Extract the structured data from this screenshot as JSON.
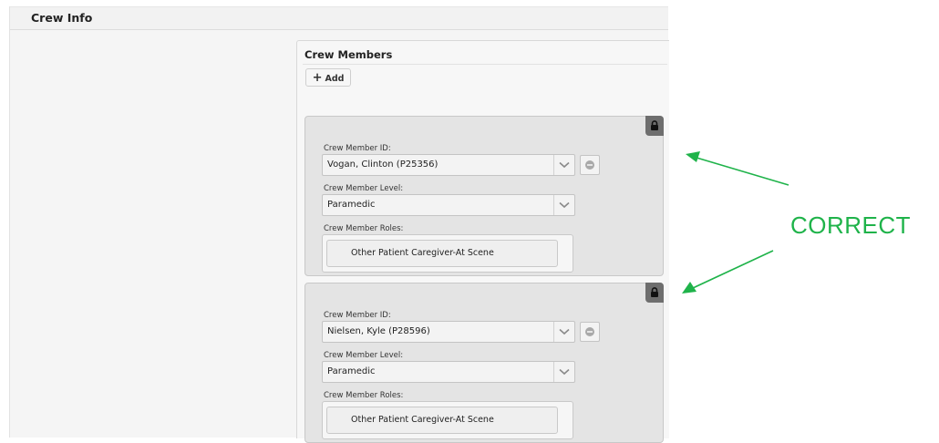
{
  "section": {
    "title": "Crew Info"
  },
  "crew_panel": {
    "title": "Crew Members",
    "add_label": "Add",
    "members": [
      {
        "id_label": "Crew Member ID:",
        "id_value": "Vogan, Clinton (P25356)",
        "level_label": "Crew Member Level:",
        "level_value": "Paramedic",
        "roles_label": "Crew Member Roles:",
        "role_tag": "Other Patient Caregiver-At Scene"
      },
      {
        "id_label": "Crew Member ID:",
        "id_value": "Nielsen, Kyle (P28596)",
        "level_label": "Crew Member Level:",
        "level_value": "Paramedic",
        "roles_label": "Crew Member Roles:",
        "role_tag": "Other Patient Caregiver-At Scene"
      }
    ]
  },
  "annotation": {
    "text": "CORRECT",
    "color": "#1fb34a"
  },
  "icons": {
    "lock": "lock-icon",
    "chevron": "chevron-down-icon",
    "remove": "minus-circle-icon",
    "plus": "plus-icon"
  }
}
